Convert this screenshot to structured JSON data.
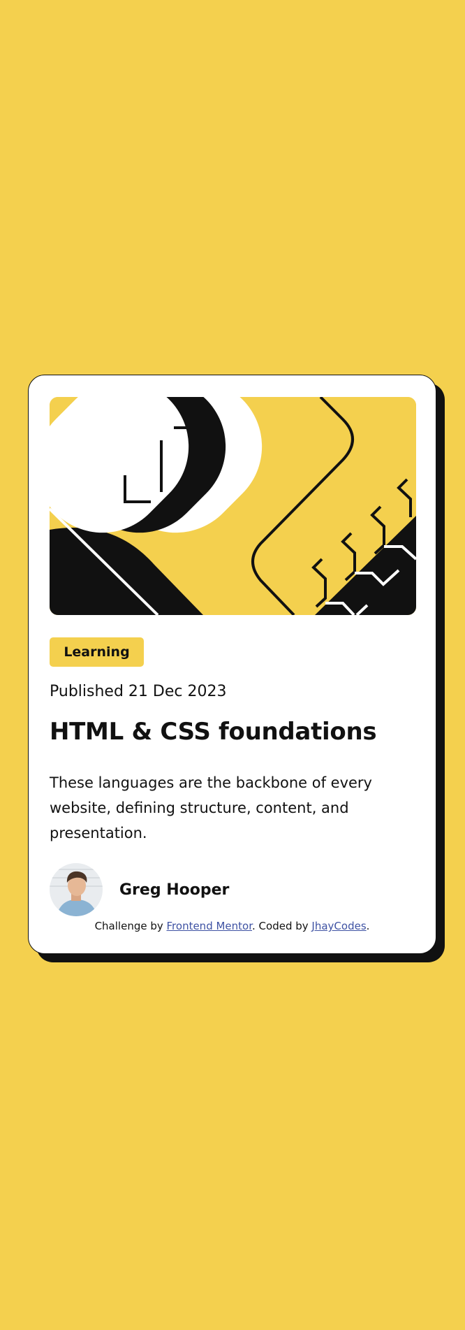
{
  "colors": {
    "background": "#F4D04E",
    "card": "#FFFFFF",
    "ink": "#111111",
    "link": "#3E52A3"
  },
  "card": {
    "illustration_icon": "abstract-geometric-illustration",
    "tag": "Learning",
    "published": "Published 21 Dec 2023",
    "title": "HTML & CSS foundations",
    "description": "These languages are the backbone of every website, defining structure, content, and presentation.",
    "author": {
      "avatar_icon": "author-avatar-photo",
      "name": "Greg Hooper"
    }
  },
  "attribution": {
    "prefix": "Challenge by ",
    "challenge_link": "Frontend Mentor",
    "middle": ". Coded by ",
    "coder_link": "JhayCodes",
    "suffix": "."
  }
}
